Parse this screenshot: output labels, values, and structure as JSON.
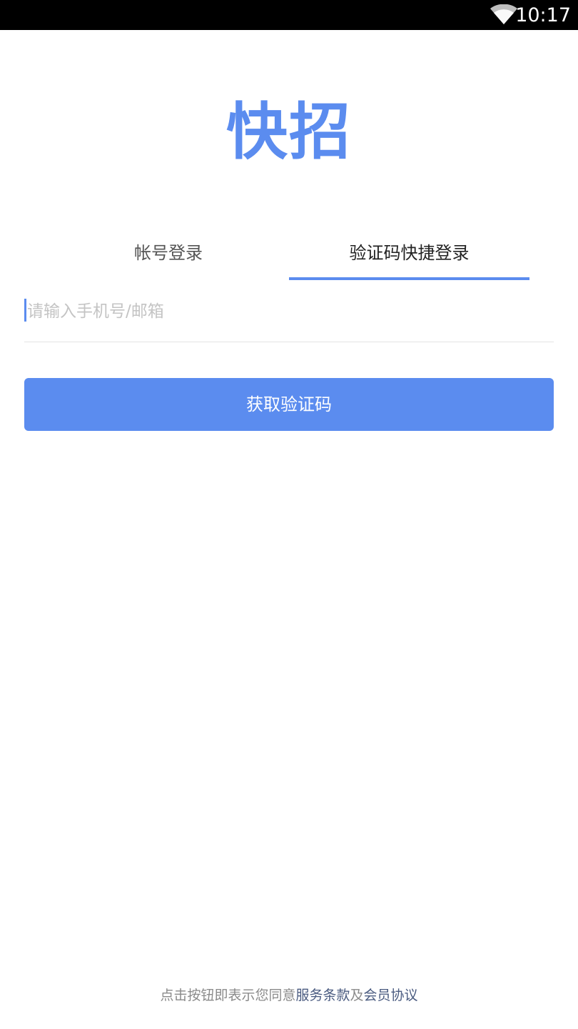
{
  "status_bar": {
    "time": "10:17",
    "wifi_icon": "wifi-icon"
  },
  "logo": {
    "text": "快招",
    "color": "#5b8cef"
  },
  "tabs": [
    {
      "label": "帐号登录",
      "active": false
    },
    {
      "label": "验证码快捷登录",
      "active": true
    }
  ],
  "phone_input": {
    "placeholder": "请输入手机号/邮箱",
    "value": ""
  },
  "get_code_button": {
    "label": "获取验证码",
    "color": "#5b8cef"
  },
  "footer": {
    "prefix": "点击按钮即表示您同意",
    "terms_link": "服务条款",
    "joiner": "及",
    "agreement_link": "会员协议"
  }
}
